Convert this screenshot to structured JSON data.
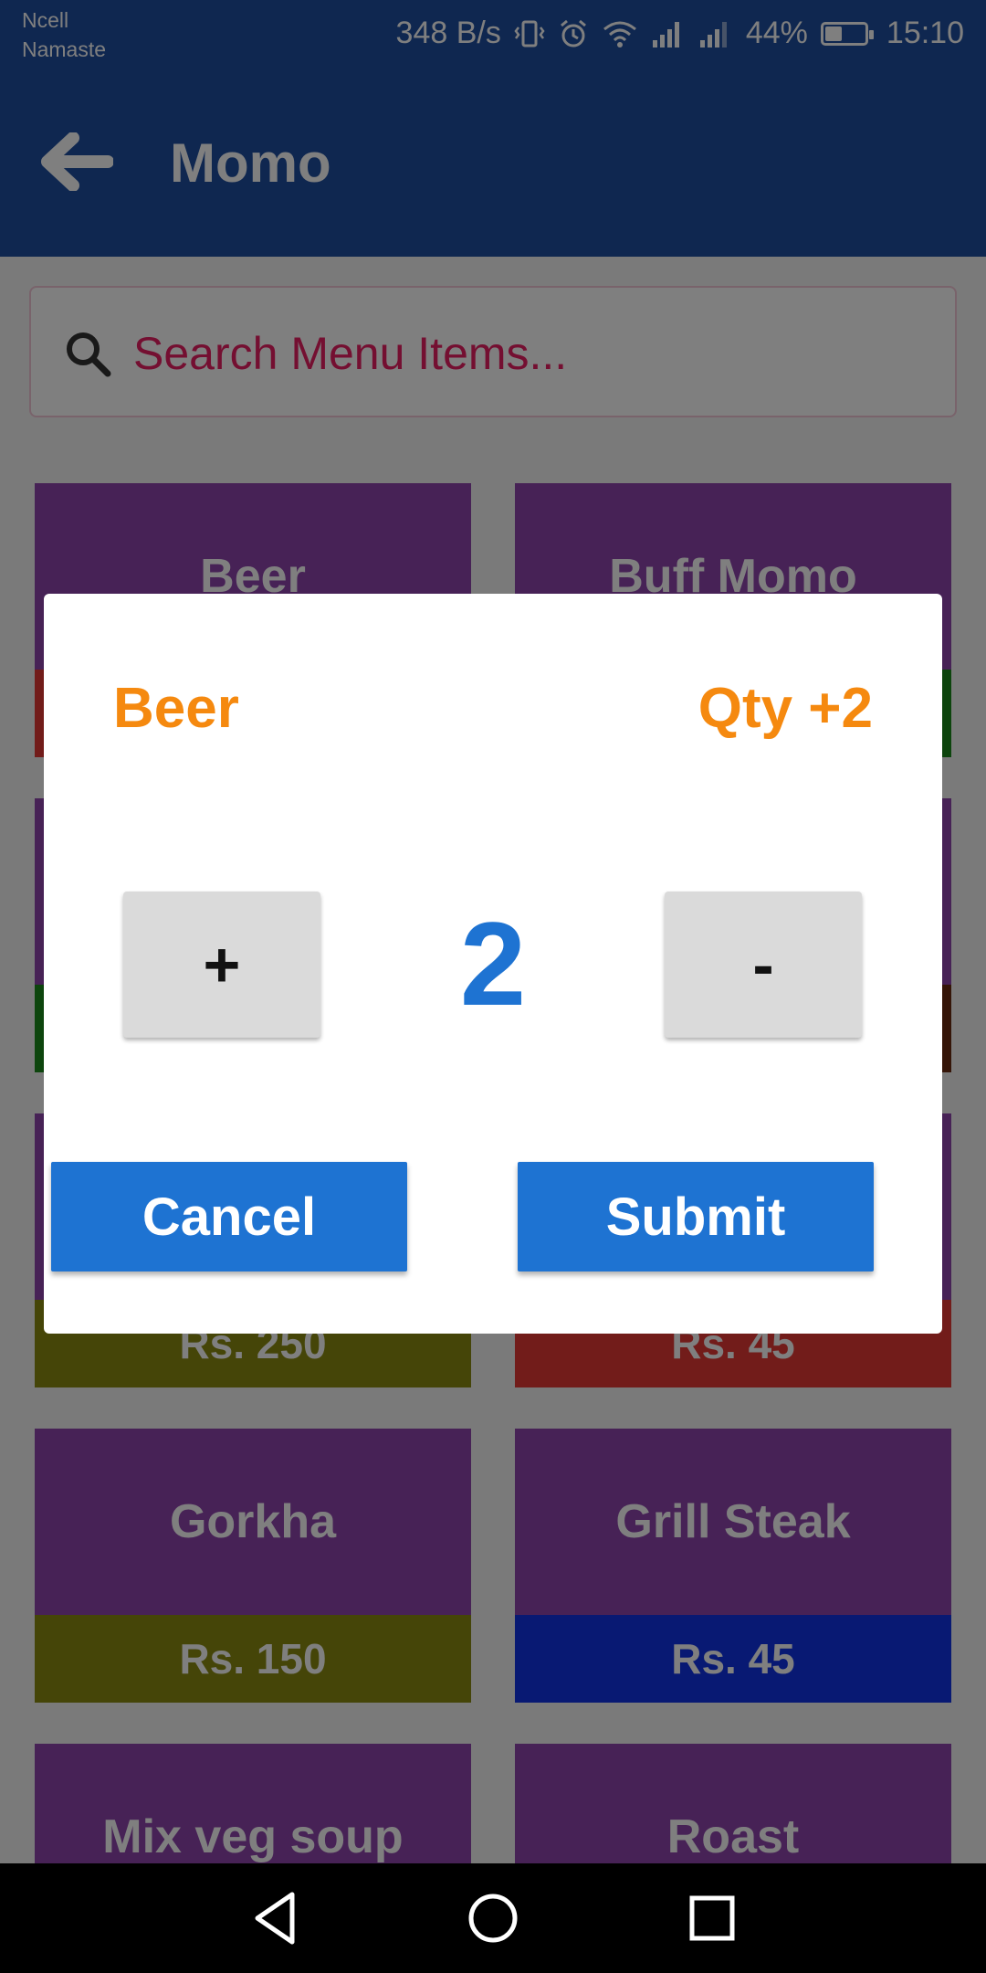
{
  "status_bar": {
    "carrier_line1": "Ncell",
    "carrier_line2": "Namaste",
    "net_speed": "348 B/s",
    "battery_percent": "44%",
    "battery_level": 0.44,
    "time": "15:10",
    "icons": [
      "vibrate-icon",
      "alarm-icon",
      "wifi-icon",
      "signal-icon",
      "signal-icon",
      "battery-icon"
    ]
  },
  "appbar": {
    "title": "Momo",
    "back_icon": "arrow-left-icon"
  },
  "search": {
    "placeholder": "Search Menu Items...",
    "icon": "search-icon"
  },
  "menu_items": [
    {
      "name": "Beer",
      "price": "",
      "price_color": "#e53935"
    },
    {
      "name": "Buff Momo",
      "price": "",
      "price_color": "#1b8a1b"
    },
    {
      "name": "",
      "price": "",
      "price_color": "#1b8a1b"
    },
    {
      "name": "",
      "price": "",
      "price_color": "#6b2a10"
    },
    {
      "name": "",
      "price": "Rs. 250",
      "price_color": "#8a8a10"
    },
    {
      "name": "",
      "price": "Rs. 45",
      "price_color": "#e53935"
    },
    {
      "name": "Gorkha",
      "price": "Rs. 150",
      "price_color": "#8a8a10"
    },
    {
      "name": "Grill Steak",
      "price": "Rs. 45",
      "price_color": "#1032e6"
    },
    {
      "name": "Mix veg soup",
      "price": "",
      "price_color": "#8e44ad"
    },
    {
      "name": "Roast",
      "price": "",
      "price_color": "#8e44ad"
    }
  ],
  "dialog": {
    "item_name": "Beer",
    "qty_label": "Qty +2",
    "plus_label": "+",
    "minus_label": "-",
    "quantity": "2",
    "cancel_label": "Cancel",
    "submit_label": "Submit"
  },
  "navbar": {
    "icons": [
      "back-triangle-icon",
      "home-circle-icon",
      "recents-square-icon"
    ]
  },
  "colors": {
    "primary": "#1f4fa1",
    "accent_orange": "#f5890f",
    "button_blue": "#1e73d2",
    "tile_purple": "#8e44ad",
    "search_text": "#e91e63"
  }
}
